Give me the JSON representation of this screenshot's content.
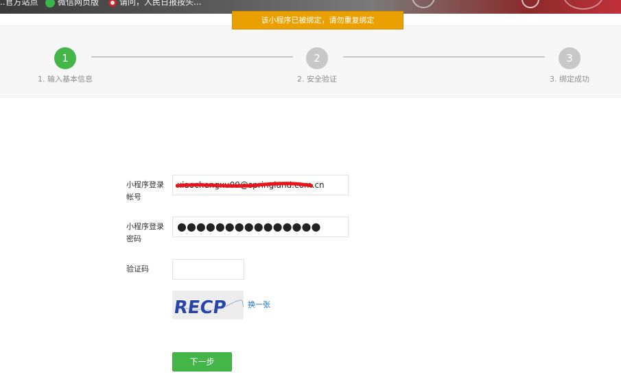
{
  "bookmarks": [
    {
      "label": "...官方站点",
      "icon": "site-icon"
    },
    {
      "label": "微信网页版",
      "icon": "wechat-icon"
    },
    {
      "label": "请问，人民日报按头...",
      "icon": "people-daily-icon"
    }
  ],
  "notice": "该小程序已被绑定，请勿重复绑定",
  "steps": [
    {
      "number": "1",
      "label": "1. 输入基本信息",
      "active": true
    },
    {
      "number": "2",
      "label": "2. 安全验证",
      "active": false
    },
    {
      "number": "3",
      "label": "3. 绑定成功",
      "active": false
    }
  ],
  "form": {
    "account_label": "小程序登录帐号",
    "account_value": "xiaochengxu09@springland.com.cn",
    "password_label": "小程序登录密码",
    "password_value": "●●●●●●●●●●●●●●●",
    "captcha_label": "验证码",
    "captcha_value": "",
    "captcha_text": "RECP",
    "refresh_label": "换一张",
    "next_label": "下一步"
  },
  "colors": {
    "accent": "#44b549",
    "notice": "#e9a000",
    "link": "#1e6fc9"
  }
}
